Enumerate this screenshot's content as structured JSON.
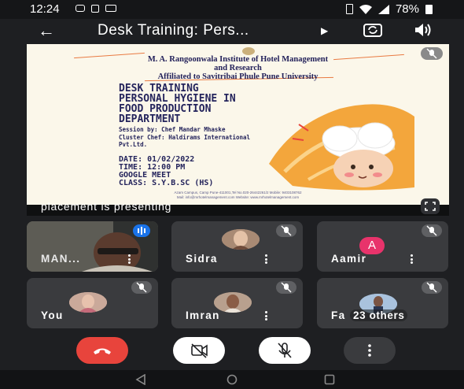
{
  "status_bar": {
    "time": "12:24",
    "battery": "78%"
  },
  "toolbar": {
    "title": "Desk Training: Pers..."
  },
  "presentation": {
    "slide": {
      "institute_line1": "M. A. Rangoonwala Institute of Hotel Management",
      "institute_line2": "and Research",
      "institute_line3": "Affiliated to Savitribai Phule Pune University",
      "heading_lines": [
        "DESK TRAINING",
        "PERSONAL HYGIENE IN",
        "FOOD PRODUCTION",
        "DEPARTMENT"
      ],
      "session_lines": [
        "Session by: Chef Mandar Mhaske",
        "Cluster Chef: Haldirams International",
        "Pvt.Ltd."
      ],
      "date_lines": [
        "DATE: 01/02/2022",
        "TIME: 12:00 PM",
        "GOOGLE MEET",
        "CLASS: S.Y.B.SC (HS)"
      ],
      "footer_line1": "Azam Campus, Camp Pune-411001,Tel No.020-26442261/2 Mobile: 9403108762",
      "footer_line2": "Mail: info@mrhotelmanagement.com Website: www.mrhotelmanagement.com"
    },
    "caption": "placement is presenting"
  },
  "participants": [
    {
      "name": "MAN...",
      "kind": "video"
    },
    {
      "name": "Sidra",
      "kind": "photo"
    },
    {
      "name": "Aamir",
      "kind": "letter",
      "initial": "A",
      "color": "#e8336b"
    },
    {
      "name": "You",
      "kind": "photo"
    },
    {
      "name": "Imran",
      "kind": "photo"
    },
    {
      "name": "Fa",
      "kind": "photo",
      "others": "23 others"
    }
  ],
  "colors": {
    "end_call": "#e8443c",
    "speaking": "#1a73e8",
    "background": "#1e1f22",
    "tile": "#3a3b3e"
  }
}
